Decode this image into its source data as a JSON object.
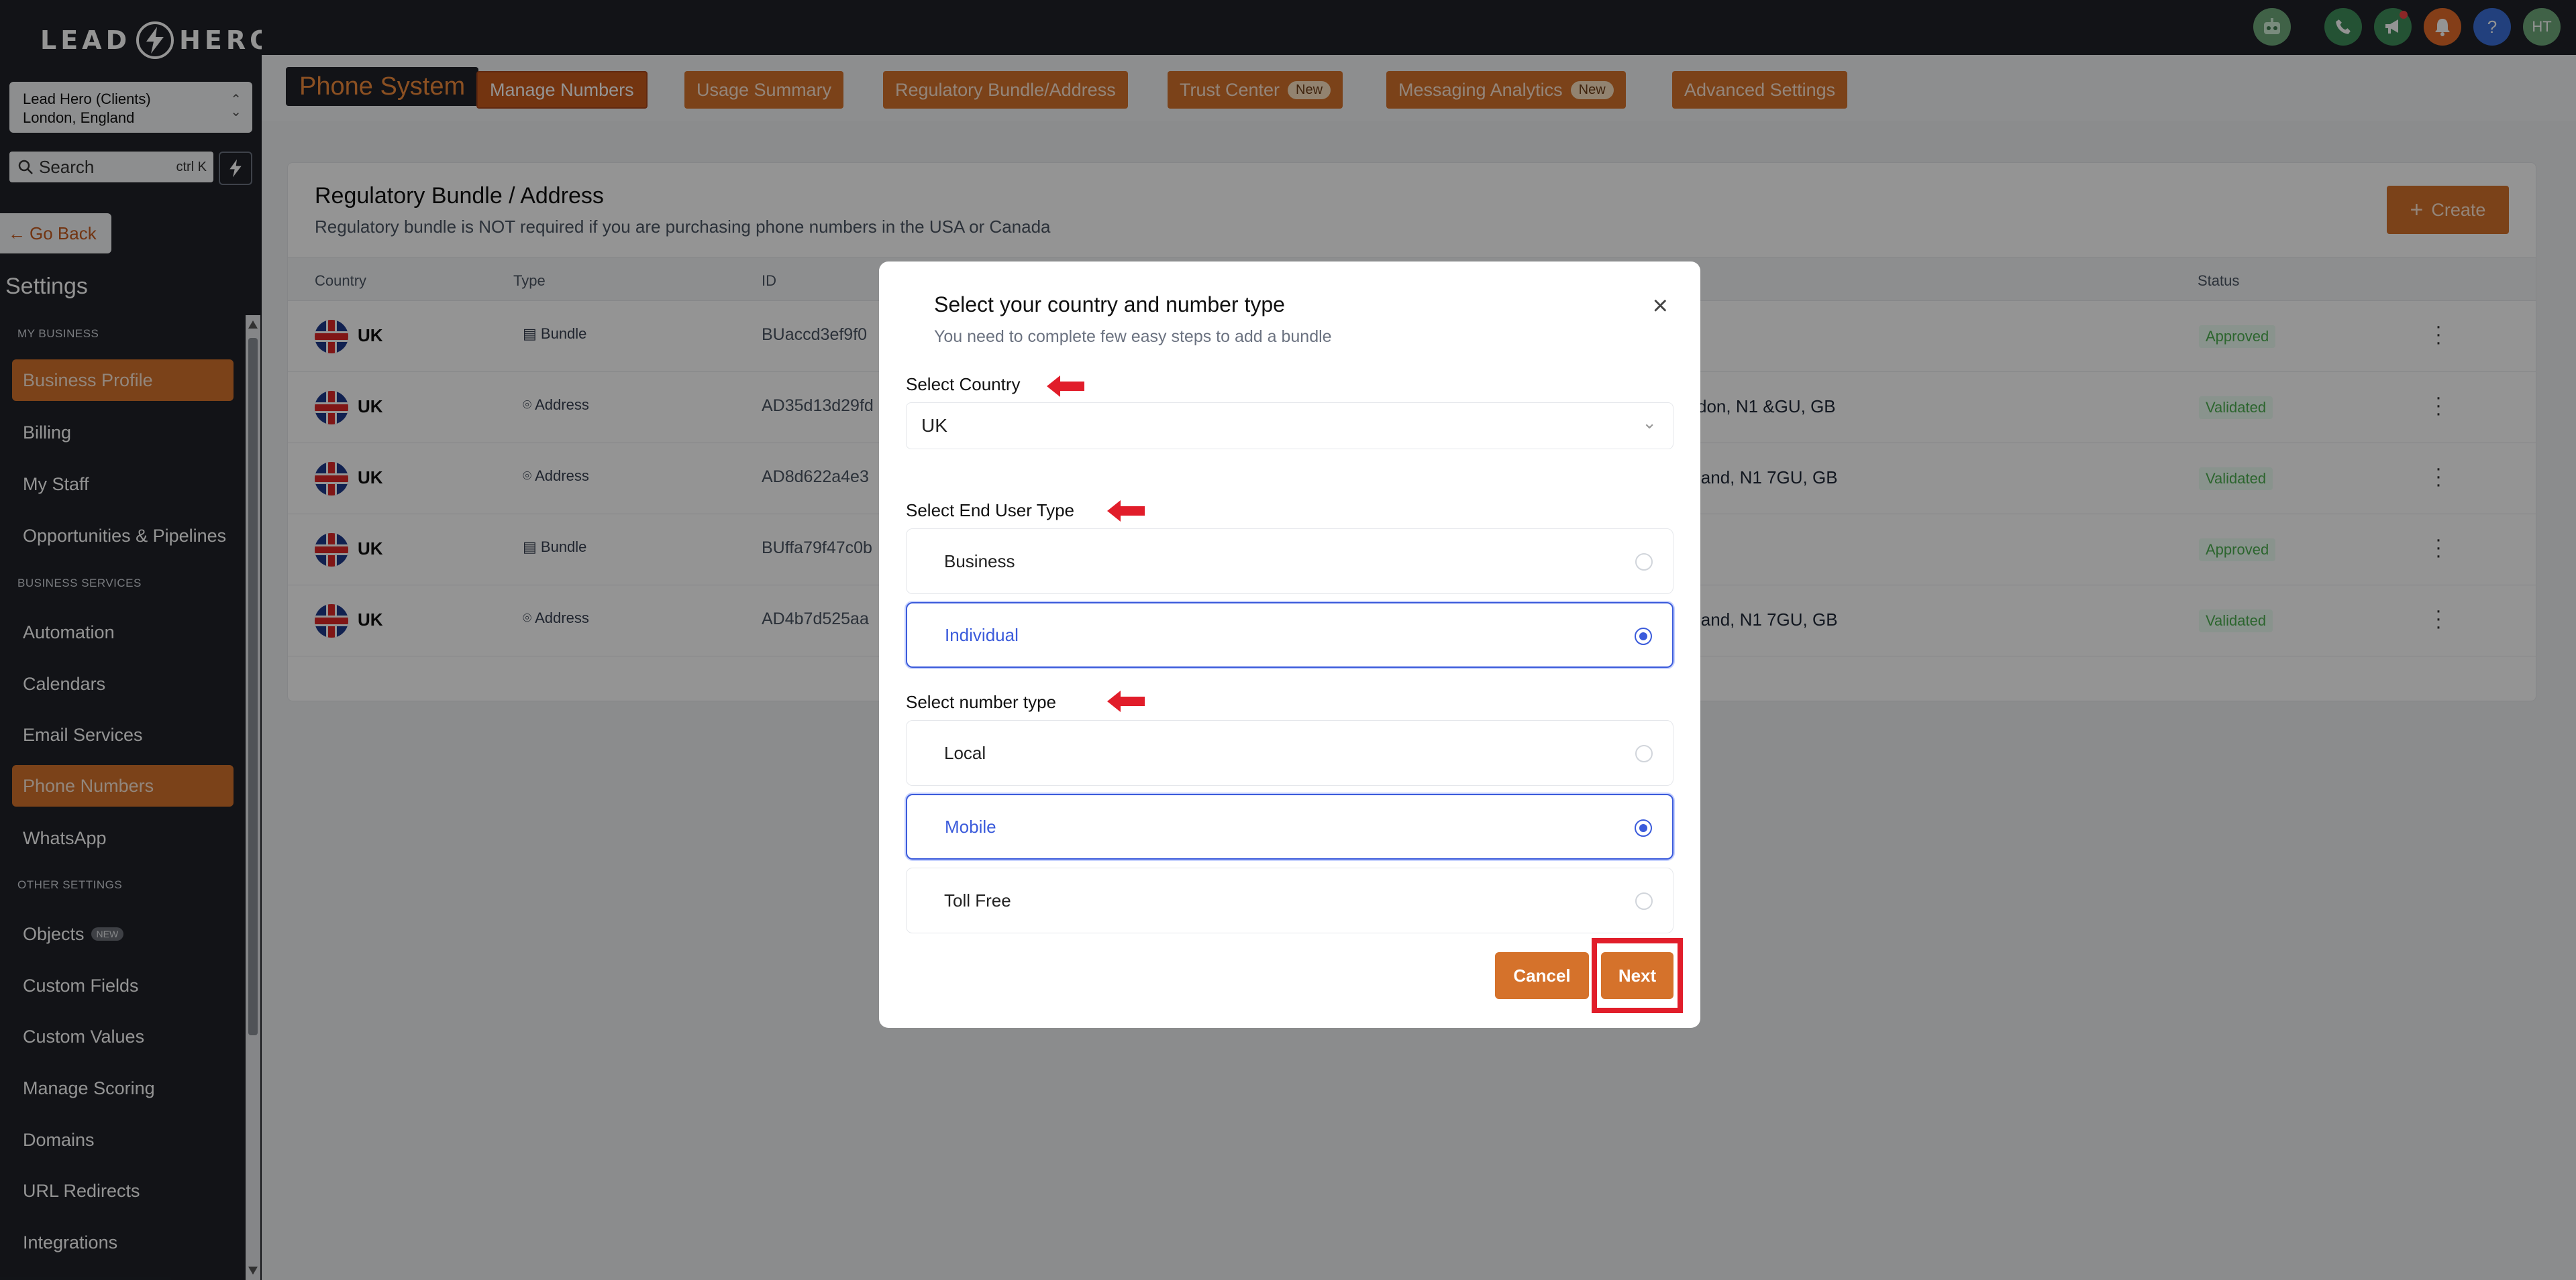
{
  "sidebar": {
    "logo_left": "LEAD",
    "logo_right": "HERO",
    "location_name": "Lead Hero (Clients)",
    "location_city": "London, England",
    "search_label": "Search",
    "search_shortcut": "ctrl K",
    "go_back": "Go Back",
    "settings_title": "Settings",
    "sections": {
      "my_business": "MY BUSINESS",
      "business_services": "BUSINESS SERVICES",
      "other_settings": "OTHER SETTINGS"
    },
    "items": {
      "business_profile": "Business Profile",
      "billing": "Billing",
      "my_staff": "My Staff",
      "opportunities": "Opportunities & Pipelines",
      "automation": "Automation",
      "calendars": "Calendars",
      "email_services": "Email Services",
      "phone_numbers": "Phone Numbers",
      "whatsapp": "WhatsApp",
      "objects": "Objects",
      "objects_badge": "NEW",
      "custom_fields": "Custom Fields",
      "custom_values": "Custom Values",
      "manage_scoring": "Manage Scoring",
      "domains": "Domains",
      "url_redirects": "URL Redirects",
      "integrations": "Integrations"
    }
  },
  "topbar": {
    "avatar_initials": "HT",
    "help_glyph": "?"
  },
  "tabs": {
    "phone_system": "Phone System",
    "manage_numbers": "Manage Numbers",
    "usage_summary": "Usage Summary",
    "regulatory": "Regulatory Bundle/Address",
    "trust_center": "Trust Center",
    "messaging_analytics": "Messaging Analytics",
    "new_badge": "New",
    "advanced_settings": "Advanced Settings"
  },
  "card": {
    "title": "Regulatory Bundle / Address",
    "subtitle": "Regulatory bundle is NOT required if you are purchasing phone numbers in the USA or Canada",
    "create_label": "Create",
    "headers": {
      "country": "Country",
      "type": "Type",
      "id": "ID",
      "status": "Status"
    },
    "rows": [
      {
        "country": "UK",
        "type": "Bundle",
        "id": "BUaccd3ef9f0",
        "address": "",
        "status": "Approved"
      },
      {
        "country": "UK",
        "type": "Address",
        "id": "AD35d13d29fd",
        "address": "don, N1 &GU, GB",
        "status": "Validated"
      },
      {
        "country": "UK",
        "type": "Address",
        "id": "AD8d622a4e3",
        "address": "land, N1 7GU, GB",
        "status": "Validated"
      },
      {
        "country": "UK",
        "type": "Bundle",
        "id": "BUffa79f47c0b",
        "address": "",
        "status": "Approved"
      },
      {
        "country": "UK",
        "type": "Address",
        "id": "AD4b7d525aa",
        "address": "land, N1 7GU, GB",
        "status": "Validated"
      }
    ]
  },
  "modal": {
    "title": "Select your country and number type",
    "subtitle": "You need to complete few easy steps to add a bundle",
    "country_label": "Select Country",
    "country_value": "UK",
    "end_user_label": "Select End User Type",
    "end_user_options": [
      {
        "label": "Business",
        "selected": false
      },
      {
        "label": "Individual",
        "selected": true
      }
    ],
    "number_type_label": "Select number type",
    "number_type_options": [
      {
        "label": "Local",
        "selected": false
      },
      {
        "label": "Mobile",
        "selected": true
      },
      {
        "label": "Toll Free",
        "selected": false
      }
    ],
    "cancel_label": "Cancel",
    "next_label": "Next"
  },
  "colors": {
    "accent": "#d5722b",
    "sidebar_bg": "#1f2229",
    "selected_blue": "#3b5bdb",
    "annotation_red": "#e11d2a"
  }
}
